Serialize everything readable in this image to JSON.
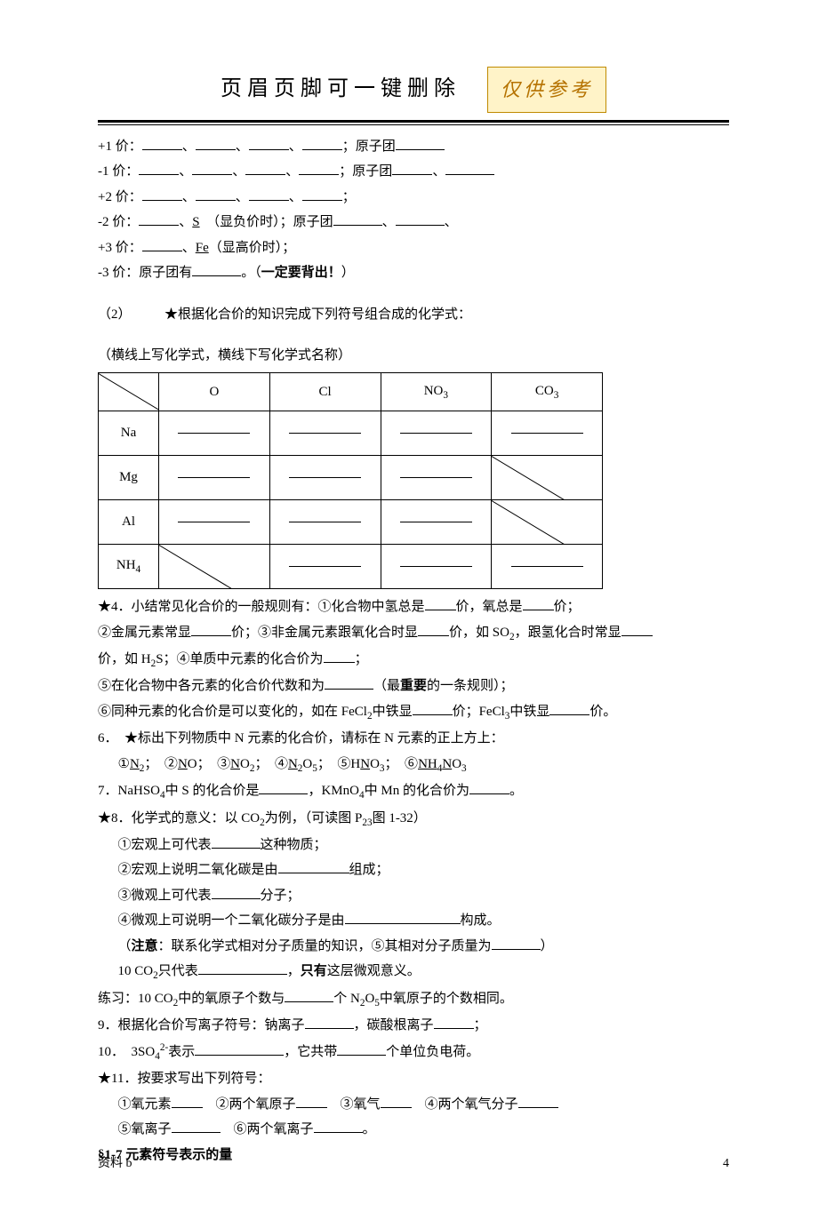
{
  "header": {
    "title": "页眉页脚可一键删除",
    "badge": "仅供参考"
  },
  "valence": {
    "p1_a": "+1 价：",
    "p1_b": "；原子团",
    "p2_a": "-1 价：",
    "p2_b": "；原子团",
    "p3_a": "+2 价：",
    "p3_b": "；",
    "p4_a": "-2 价：",
    "p4_b": "、",
    "p4_s": "S",
    "p4_c": "（显负价时）；原子团",
    "p5_a": "+3 价：",
    "p5_b": "、",
    "p5_fe": "Fe",
    "p5_c": "（显高价时）；",
    "p6_a": "-3 价：原子团有",
    "p6_b": "。（",
    "p6_bold": "一定要背出！",
    "p6_c": "）"
  },
  "section2": {
    "label": "（2）",
    "star": "★根据化合价的知识完成下列符号组合成的化学式：",
    "note": "（横线上写化学式，横线下写化学式名称）"
  },
  "table": {
    "cols": [
      "O",
      "Cl",
      "NO",
      "CO"
    ],
    "col_sub": [
      "",
      "",
      "3",
      "3"
    ],
    "rows": [
      "Na",
      "Mg",
      "Al",
      "NH"
    ],
    "row_sub": [
      "",
      "",
      "",
      "4"
    ]
  },
  "q4": {
    "a": "★4．小结常见化合价的一般规则有：①化合物中氢总是",
    "b": "价，氧总是",
    "c": "价；",
    "d": "②金属元素常显",
    "e": "价；③非金属元素跟氧化合时显",
    "f": "价，如 SO",
    "f_sub": "2",
    "g": "，跟氢化合时常显",
    "h": "价，如 H",
    "h_sub": "2",
    "i": "S；④单质中元素的化合价为",
    "j": "；",
    "k": "⑤在化合物中各元素的化合价代数和为",
    "l": "（最",
    "l_bold": "重要",
    "m": "的一条规则）；",
    "n": "⑥同种元素的化合价是可以变化的，如在 FeCl",
    "n_sub": "2",
    "o": "中铁显",
    "p": "价；FeCl",
    "p_sub": "3",
    "q": "中铁显",
    "r": "价。"
  },
  "q6": {
    "a": "6．　★标出下列物质中 N 元素的化合价，请标在 N 元素的正上方上：",
    "items_prefix": "①",
    "n2_a": "N",
    "n2_sub": "2",
    "n2_b": "；　②",
    "no_a": "N",
    "no_b": "O；　③",
    "no2_a": "N",
    "no2_b": "O",
    "no2_sub": "2",
    "no2_c": "；　④",
    "n2o5_a": "N",
    "n2o5_sub1": "2",
    "n2o5_b": "O",
    "n2o5_sub2": "5",
    "n2o5_c": "；　⑤H",
    "hno3_a": "N",
    "hno3_b": "O",
    "hno3_sub": "3",
    "hno3_c": "；　⑥",
    "nh4no3_a": "NH",
    "nh4no3_sub1": "4",
    "nh4no3_b": "N",
    "nh4no3_c": "O",
    "nh4no3_sub2": "3"
  },
  "q7": {
    "a": "7．NaHSO",
    "a_sub": "4",
    "b": "中 S 的化合价是",
    "c": "，KMnO",
    "c_sub": "4",
    "d": "中 Mn 的化合价为",
    "e": "。"
  },
  "q8": {
    "a": "★8．化学式的意义：以 CO",
    "a_sub": "2",
    "b": "为例，（可读图 P",
    "b_sub": "23",
    "c": "图 1-32）",
    "l1a": "①宏观上可代表",
    "l1b": "这种物质；",
    "l2a": "②宏观上说明二氧化碳是由",
    "l2b": "组成；",
    "l3a": "③微观上可代表",
    "l3b": "分子；",
    "l4a": "④微观上可说明一个二氧化碳分子是由",
    "l4b": "构成。",
    "l5a": "（",
    "l5_bold": "注意",
    "l5b": "：联系化学式相对分子质量的知识，⑤其相对分子质量为",
    "l5c": "）",
    "l6a": "10 CO",
    "l6_sub": "2",
    "l6b": "只代表",
    "l6c": "，",
    "l6_bold": "只有",
    "l6d": "这层微观意义。"
  },
  "practice": {
    "a": "练习：10 CO",
    "a_sub": "2",
    "b": "中的氧原子个数与",
    "c": "个 N",
    "c_sub1": "2",
    "d": "O",
    "c_sub2": "5",
    "e": "中氧原子的个数相同。"
  },
  "q9": {
    "a": "9．根据化合价写离子符号：钠离子",
    "b": "，碳酸根离子",
    "c": "；"
  },
  "q10": {
    "a": "10．　3SO",
    "a_sub": "4",
    "a_sup": "2-",
    "b": "表示",
    "c": "，它共带",
    "d": "个单位负电荷。"
  },
  "q11": {
    "a": "★11．按要求写出下列符号：",
    "l1": "①氧元素",
    "l2": "　②两个氧原子",
    "l3": "　③氧气",
    "l4": "　④两个氧气分子",
    "l5": "⑤氧离子",
    "l6": "　⑥两个氧离子",
    "l7": "。"
  },
  "section17": "§1-7 元素符号表示的量",
  "footer": {
    "left": "资料 b",
    "right": "4"
  }
}
